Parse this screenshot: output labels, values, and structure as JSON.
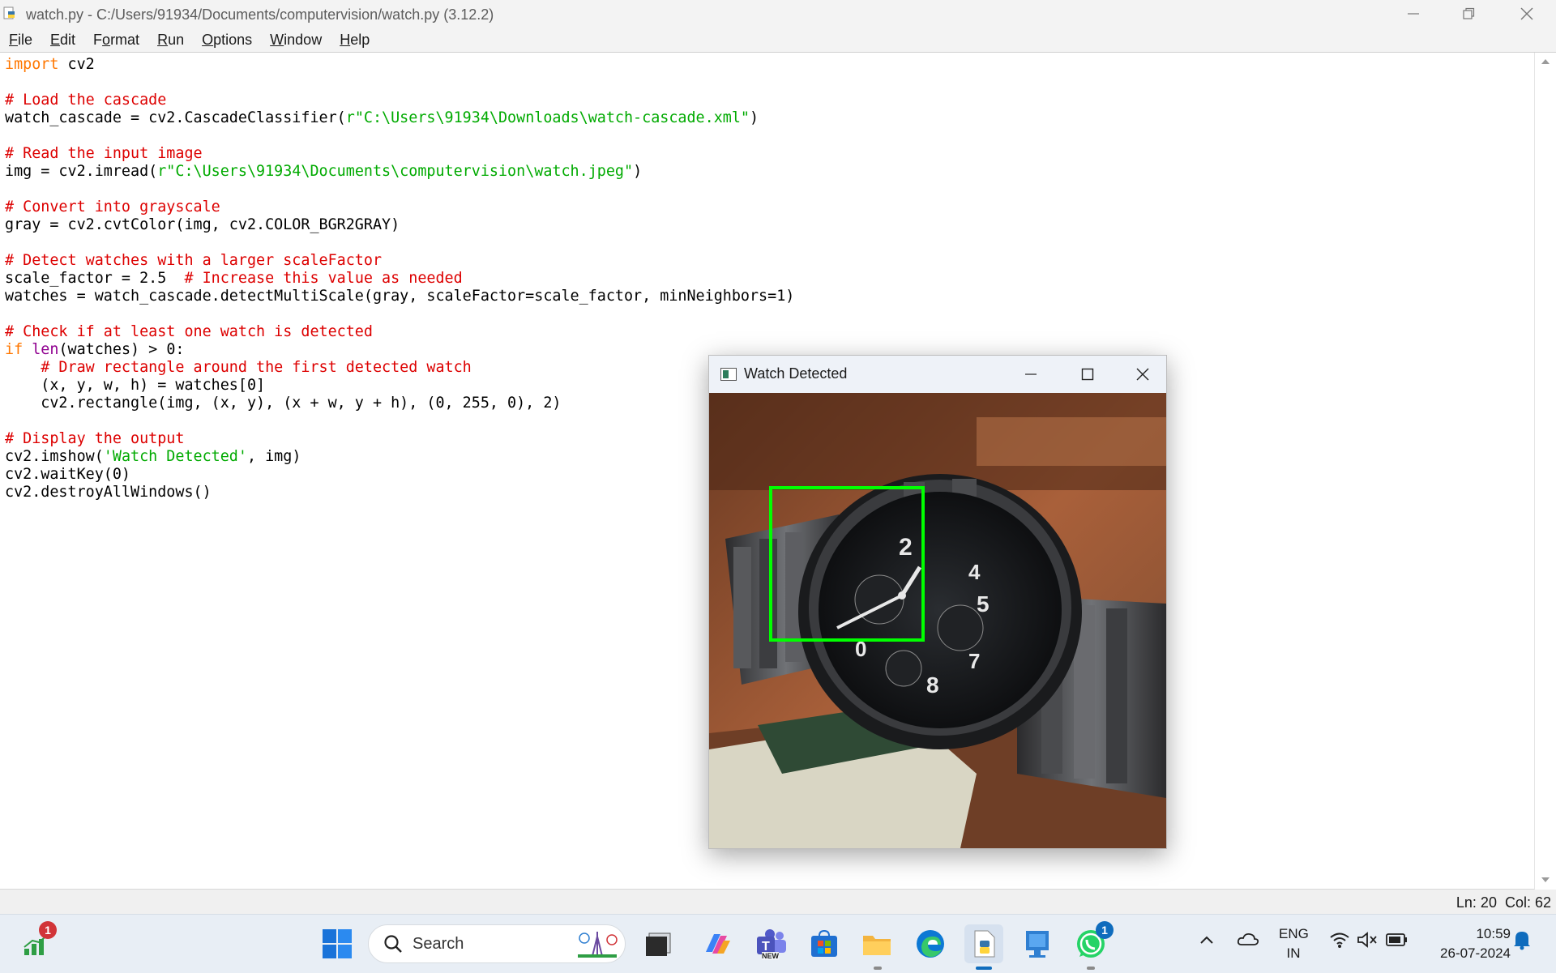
{
  "window": {
    "title": "watch.py - C:/Users/91934/Documents/computervision/watch.py (3.12.2)"
  },
  "menu": [
    "File",
    "Edit",
    "Format",
    "Run",
    "Options",
    "Window",
    "Help"
  ],
  "menu_underline": [
    "F",
    "E",
    "o",
    "R",
    "O",
    "W",
    "H"
  ],
  "code": {
    "l1_kw": "import",
    "l1_rest": " cv2",
    "l3": "# Load the cascade",
    "l4_a": "watch_cascade = cv2.CascadeClassifier(",
    "l4_s": "r\"C:\\Users\\91934\\Downloads\\watch-cascade.xml\"",
    "l4_b": ")",
    "l6": "# Read the input image",
    "l7_a": "img = cv2.imread(",
    "l7_s": "r\"C:\\Users\\91934\\Documents\\computervision\\watch.jpeg\"",
    "l7_b": ")",
    "l9": "# Convert into grayscale",
    "l10": "gray = cv2.cvtColor(img, cv2.COLOR_BGR2GRAY)",
    "l12": "# Detect watches with a larger scaleFactor",
    "l13_a": "scale_factor = 2.5  ",
    "l13_c": "# Increase this value as needed",
    "l14": "watches = watch_cascade.detectMultiScale(gray, scaleFactor=scale_factor, minNeighbors=1)",
    "l16": "# Check if at least one watch is detected",
    "l17_kw": "if",
    "l17_sp": " ",
    "l17_bi": "len",
    "l17_rest": "(watches) > 0:",
    "l18": "    # Draw rectangle around the first detected watch",
    "l19": "    (x, y, w, h) = watches[0]",
    "l20": "    cv2.rectangle(img, (x, y), (x + w, y + h), (0, 255, 0), 2)",
    "l22": "# Display the output",
    "l23_a": "cv2.imshow(",
    "l23_s": "'Watch Detected'",
    "l23_b": ", img)",
    "l24": "cv2.waitKey(0)",
    "l25": "cv2.destroyAllWindows()"
  },
  "status": {
    "line": "Ln: 20",
    "col": "Col: 62"
  },
  "popup": {
    "title": "Watch Detected",
    "box_color": "#00ff00"
  },
  "taskbar": {
    "search_placeholder": "Search",
    "chart_badge": "1",
    "whatsapp_badge": "1",
    "teams_label": "NEW",
    "lang_line1": "ENG",
    "lang_line2": "IN",
    "time": "10:59",
    "date": "26-07-2024"
  },
  "colors": {
    "keyword": "#ff7700",
    "comment": "#dd0000",
    "string": "#00aa00",
    "builtin": "#900090",
    "badge_red": "#d13438",
    "badge_blue": "#0f6cbd"
  }
}
